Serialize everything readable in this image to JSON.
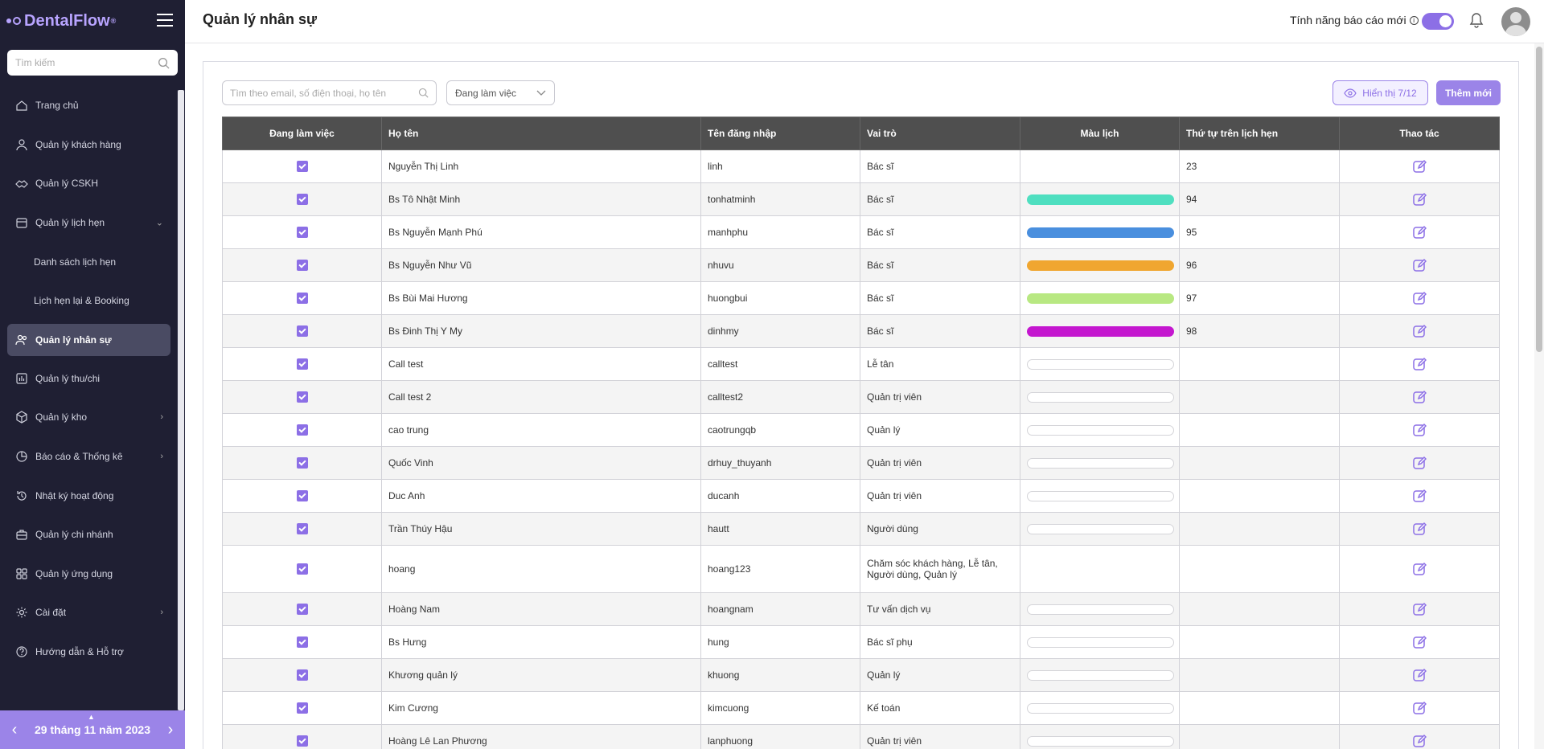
{
  "app": {
    "name": "DentalFlow",
    "trademark": "®"
  },
  "sidebar": {
    "search_placeholder": "Tìm kiếm",
    "items": [
      {
        "label": "Trang chủ",
        "icon": "home-icon",
        "arrow": "",
        "sub": false,
        "active": false
      },
      {
        "label": "Quản lý khách hàng",
        "icon": "user-icon",
        "arrow": "",
        "sub": false,
        "active": false
      },
      {
        "label": "Quản lý CSKH",
        "icon": "handshake-icon",
        "arrow": "",
        "sub": false,
        "active": false
      },
      {
        "label": "Quản lý lịch hẹn",
        "icon": "calendar-icon",
        "arrow": "⌄",
        "sub": false,
        "active": false
      },
      {
        "label": "Danh sách lịch hẹn",
        "icon": "",
        "arrow": "",
        "sub": true,
        "active": false
      },
      {
        "label": "Lịch hẹn lại & Booking",
        "icon": "",
        "arrow": "",
        "sub": true,
        "active": false
      },
      {
        "label": "Quản lý nhân sự",
        "icon": "users-icon",
        "arrow": "",
        "sub": false,
        "active": true
      },
      {
        "label": "Quản lý thu/chi",
        "icon": "chart-bar-icon",
        "arrow": "",
        "sub": false,
        "active": false
      },
      {
        "label": "Quản lý kho",
        "icon": "box-icon",
        "arrow": "›",
        "sub": false,
        "active": false
      },
      {
        "label": "Báo cáo & Thống kê",
        "icon": "pie-chart-icon",
        "arrow": "›",
        "sub": false,
        "active": false
      },
      {
        "label": "Nhật ký hoạt động",
        "icon": "history-icon",
        "arrow": "",
        "sub": false,
        "active": false
      },
      {
        "label": "Quản lý chi nhánh",
        "icon": "briefcase-icon",
        "arrow": "",
        "sub": false,
        "active": false
      },
      {
        "label": "Quản lý ứng dụng",
        "icon": "apps-icon",
        "arrow": "",
        "sub": false,
        "active": false
      },
      {
        "label": "Cài đặt",
        "icon": "gear-icon",
        "arrow": "›",
        "sub": false,
        "active": false
      },
      {
        "label": "Hướng dẫn & Hỗ trợ",
        "icon": "help-icon",
        "arrow": "",
        "sub": false,
        "active": false
      }
    ],
    "date_label": "29 tháng 11 năm 2023",
    "prev": "‹",
    "next": "›",
    "caret": "▲"
  },
  "header": {
    "title": "Quản lý nhân sự",
    "feature_label": "Tính năng báo cáo mới",
    "feature_info": "i",
    "toggle_on": true
  },
  "toolbar": {
    "search_placeholder": "Tìm theo email, số điện thoại, họ tên",
    "filter_value": "Đang làm việc",
    "show_label": "Hiển thị 7/12",
    "add_label": "Thêm mới"
  },
  "table": {
    "columns": [
      "Đang làm việc",
      "Họ tên",
      "Tên đăng nhập",
      "Vai trò",
      "Màu lịch",
      "Thứ tự trên lịch hẹn",
      "Thao tác"
    ],
    "rows": [
      {
        "checked": true,
        "name": "Nguyễn Thị Linh",
        "username": "linh",
        "role": "Bác sĩ",
        "color": "",
        "order": "23"
      },
      {
        "checked": true,
        "name": "Bs Tô Nhật Minh",
        "username": "tonhatminh",
        "role": "Bác sĩ",
        "color": "#4fdfc0",
        "order": "94"
      },
      {
        "checked": true,
        "name": "Bs Nguyễn Mạnh Phú",
        "username": "manhphu",
        "role": "Bác sĩ",
        "color": "#4a8fde",
        "order": "95"
      },
      {
        "checked": true,
        "name": "Bs Nguyễn Như Vũ",
        "username": "nhuvu",
        "role": "Bác sĩ",
        "color": "#f0a630",
        "order": "96"
      },
      {
        "checked": true,
        "name": "Bs Bùi Mai Hương",
        "username": "huongbui",
        "role": "Bác sĩ",
        "color": "#b8e882",
        "order": "97"
      },
      {
        "checked": true,
        "name": "Bs Đinh Thị Y My",
        "username": "dinhmy",
        "role": "Bác sĩ",
        "color": "#c417cf",
        "order": "98"
      },
      {
        "checked": true,
        "name": "Call test",
        "username": "calltest",
        "role": "Lễ tân",
        "color": "empty",
        "order": ""
      },
      {
        "checked": true,
        "name": "Call test 2",
        "username": "calltest2",
        "role": "Quản trị viên",
        "color": "empty",
        "order": ""
      },
      {
        "checked": true,
        "name": "cao trung",
        "username": "caotrungqb",
        "role": "Quản lý",
        "color": "empty",
        "order": ""
      },
      {
        "checked": true,
        "name": "Quốc Vinh",
        "username": "drhuy_thuyanh",
        "role": "Quản trị viên",
        "color": "empty",
        "order": ""
      },
      {
        "checked": true,
        "name": "Duc Anh",
        "username": "ducanh",
        "role": "Quản trị viên",
        "color": "empty",
        "order": ""
      },
      {
        "checked": true,
        "name": "Trần Thúy Hậu",
        "username": "hautt",
        "role": "Người dùng",
        "color": "empty",
        "order": ""
      },
      {
        "checked": true,
        "name": "hoang",
        "username": "hoang123",
        "role": "Chăm sóc khách hàng, Lễ tân, Người dùng, Quản lý",
        "color": "",
        "order": ""
      },
      {
        "checked": true,
        "name": "Hoàng Nam",
        "username": "hoangnam",
        "role": "Tư vấn dịch vụ",
        "color": "empty",
        "order": ""
      },
      {
        "checked": true,
        "name": "Bs Hưng",
        "username": "hung",
        "role": "Bác sĩ phụ",
        "color": "empty",
        "order": ""
      },
      {
        "checked": true,
        "name": "Khương quản lý",
        "username": "khuong",
        "role": "Quản lý",
        "color": "empty",
        "order": ""
      },
      {
        "checked": true,
        "name": "Kim Cương",
        "username": "kimcuong",
        "role": "Kế toán",
        "color": "empty",
        "order": ""
      },
      {
        "checked": true,
        "name": "Hoàng Lê Lan Phương",
        "username": "lanphuong",
        "role": "Quản trị viên",
        "color": "empty",
        "order": ""
      }
    ]
  },
  "colors": {
    "accent": "#9b84e8",
    "sidebar_bg": "#1f1f33",
    "header_bg": "#4f4f4f"
  }
}
